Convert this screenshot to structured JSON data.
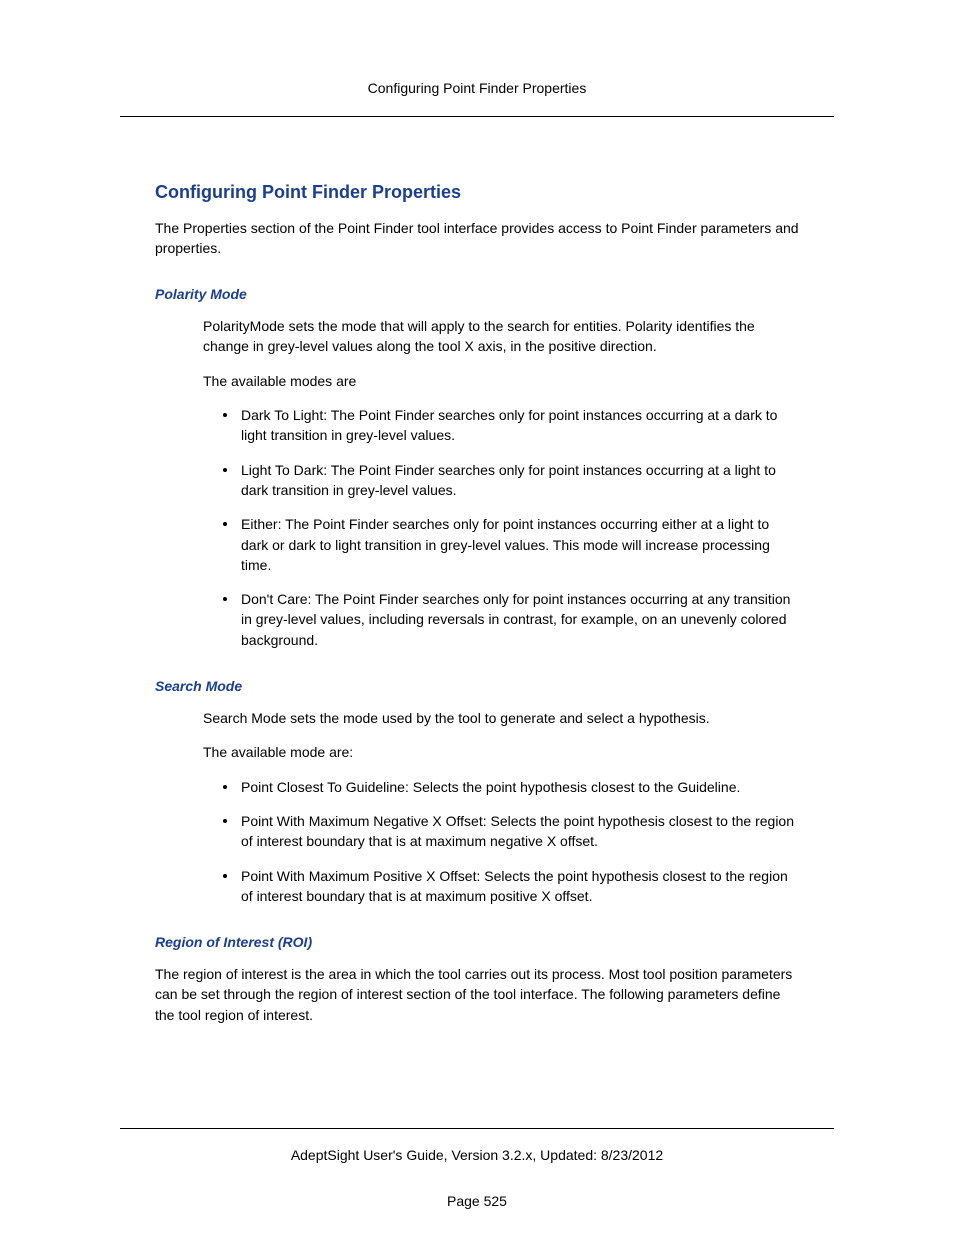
{
  "header": {
    "running_title": "Configuring Point Finder Properties"
  },
  "main": {
    "title": "Configuring Point Finder Properties",
    "intro": "The Properties section of the Point Finder tool interface provides access to Point Finder parameters and properties.",
    "sections": {
      "polarity": {
        "heading": "Polarity Mode",
        "p1": "PolarityMode sets the mode that will apply to the search for entities. Polarity identifies the change in grey-level values along the tool X axis, in the positive direction.",
        "p2": "The available modes are",
        "items": [
          "Dark To Light: The Point Finder searches only for point instances occurring at a dark to light transition in grey-level values.",
          "Light To Dark: The Point Finder searches only for point instances occurring at a light to dark transition in grey-level values.",
          "Either: The Point Finder searches only for point instances occurring either at a light to dark or dark to light transition in grey-level values. This mode will increase processing time.",
          "Don't Care: The Point Finder searches only for point instances occurring at any transition in grey-level values, including reversals in contrast, for example, on an unevenly colored background."
        ]
      },
      "search": {
        "heading": "Search Mode",
        "p1": "Search Mode sets the mode used by the tool to generate and select a hypothesis.",
        "p2": "The available mode are:",
        "items": [
          "Point Closest To Guideline: Selects the point hypothesis closest to the Guideline.",
          "Point With Maximum Negative X Offset: Selects the point hypothesis closest to the region of interest boundary that is at maximum negative X offset.",
          "Point With Maximum Positive X Offset: Selects the point hypothesis closest to the region of interest boundary that is at maximum positive X offset."
        ]
      },
      "roi": {
        "heading": "Region of Interest (ROI)",
        "p1": "The region of interest is the area in which the tool carries out its process. Most tool position parameters can be set through the region of interest section of the tool interface. The following parameters define the tool region of interest."
      }
    }
  },
  "footer": {
    "line": "AdeptSight User's Guide,  Version 3.2.x,  Updated: 8/23/2012",
    "page": "Page 525"
  }
}
